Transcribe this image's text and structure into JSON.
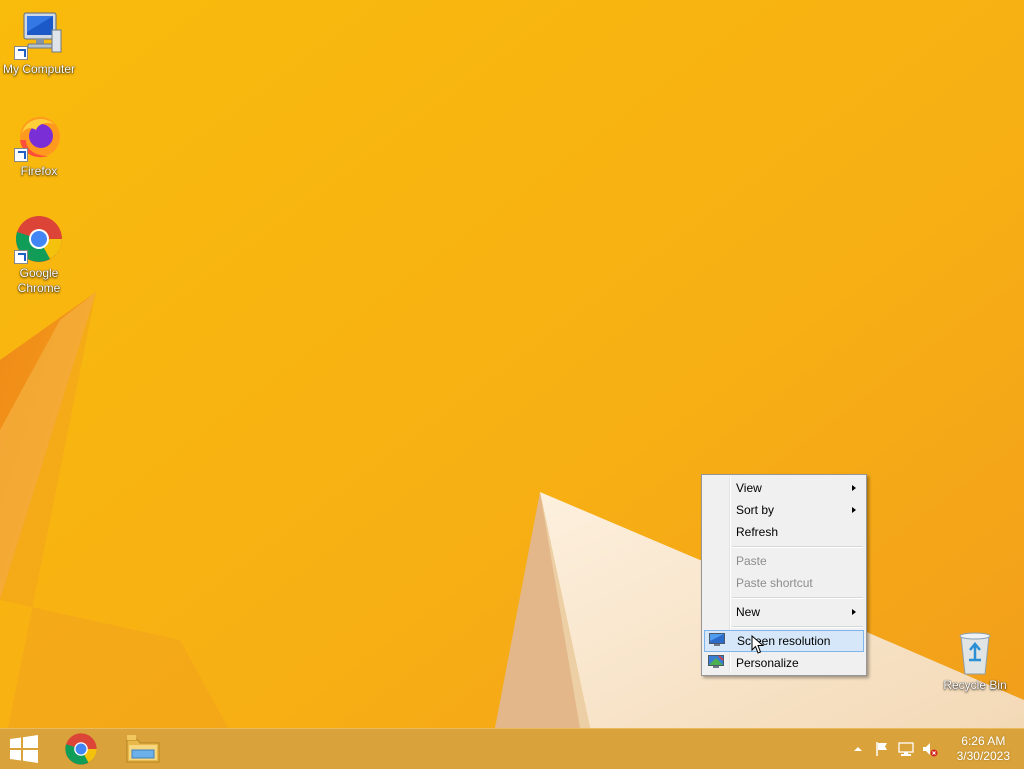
{
  "desktop": {
    "icons": [
      {
        "label": "My Computer",
        "icon": "computer-icon"
      },
      {
        "label": "Firefox",
        "icon": "firefox-icon"
      },
      {
        "label": "Google Chrome",
        "icon": "chrome-icon"
      },
      {
        "label": "Recycle Bin",
        "icon": "recycle-bin-icon"
      }
    ]
  },
  "context_menu": {
    "items": {
      "view": "View",
      "sort_by": "Sort by",
      "refresh": "Refresh",
      "paste": "Paste",
      "paste_shortcut": "Paste shortcut",
      "new": "New",
      "screen_resolution": "Screen resolution",
      "personalize": "Personalize"
    },
    "highlighted": "Screen resolution",
    "disabled": [
      "Paste",
      "Paste shortcut"
    ]
  },
  "taskbar": {
    "pinned": [
      "start-button",
      "chrome-icon",
      "file-explorer-icon"
    ],
    "tray_icons": [
      "show-hidden-icons-chevron",
      "action-center-flag-icon",
      "network-icon",
      "volume-muted-icon"
    ],
    "clock": {
      "time": "6:26 AM",
      "date": "3/30/2023"
    }
  },
  "colors": {
    "wallpaper": "#f7b310",
    "menu_highlight": "#d5e7f8",
    "menu_highlight_border": "#7eb4ea"
  }
}
